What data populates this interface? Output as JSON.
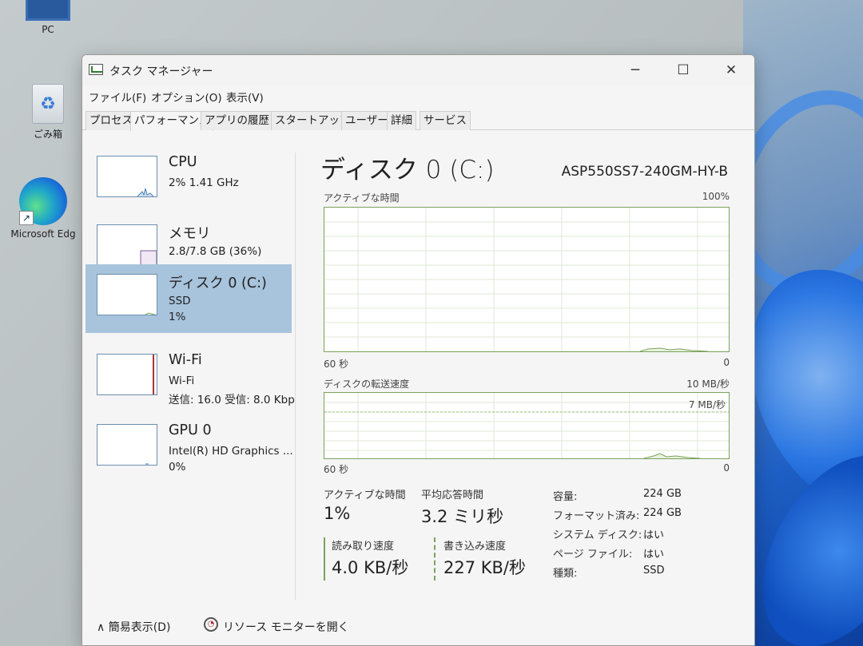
{
  "desktop": {
    "icons": [
      {
        "label": "PC",
        "icon": "computer-icon"
      },
      {
        "label": "ごみ箱",
        "icon": "recycle-bin-icon"
      },
      {
        "label": "Microsoft Edg",
        "icon": "edge-icon"
      }
    ]
  },
  "window": {
    "title": "タスク マネージャー",
    "controls": {
      "minimize": "─",
      "maximize": "☐",
      "close": "✕"
    }
  },
  "menu": [
    "ファイル(F)",
    "オプション(O)",
    "表示(V)"
  ],
  "tabs": [
    "プロセス",
    "パフォーマンス",
    "アプリの履歴",
    "スタートアップ",
    "ユーザー",
    "詳細",
    "サービス"
  ],
  "active_tab": "パフォーマンス",
  "sidebar": {
    "cpu": {
      "name": "CPU",
      "line1": "2% 1.41 GHz"
    },
    "memory": {
      "name": "メモリ",
      "line1": "2.8/7.8 GB (36%)"
    },
    "disk": {
      "name": "ディスク 0 (C:)",
      "line1": "SSD",
      "line2": "1%"
    },
    "wifi": {
      "name": "Wi-Fi",
      "line1": "Wi-Fi",
      "line2": "送信: 16.0 受信: 8.0 Kbp"
    },
    "gpu": {
      "name": "GPU 0",
      "line1": "Intel(R) HD Graphics ...",
      "line2": "0%"
    }
  },
  "detail": {
    "title": "ディスク 0 (C:)",
    "model": "ASP550SS7-240GM-HY-B",
    "active_chart": {
      "label": "アクティブな時間",
      "max": "100%",
      "left": "60 秒",
      "right": "0"
    },
    "transfer_chart": {
      "label": "ディスクの転送速度",
      "max": "10 MB/秒",
      "secondary": "7 MB/秒",
      "left": "60 秒",
      "right": "0"
    },
    "stats": {
      "active_time_label": "アクティブな時間",
      "active_time": "1%",
      "response_label": "平均応答時間",
      "response": "3.2 ミリ秒",
      "read_label": "読み取り速度",
      "read": "4.0 KB/秒",
      "write_label": "書き込み速度",
      "write": "227 KB/秒"
    },
    "props": [
      {
        "k": "容量:",
        "v": "224 GB"
      },
      {
        "k": "フォーマット済み:",
        "v": "224 GB"
      },
      {
        "k": "システム ディスク:",
        "v": "はい"
      },
      {
        "k": "ページ ファイル:",
        "v": "はい"
      },
      {
        "k": "種類:",
        "v": "SSD"
      }
    ]
  },
  "footer": {
    "fewer": "簡易表示(D)",
    "resmon": "リソース モニターを開く"
  },
  "colors": {
    "selected": "#a8c3dc",
    "disk_green": "#7aa25a",
    "grid": "#dfe8d6"
  }
}
